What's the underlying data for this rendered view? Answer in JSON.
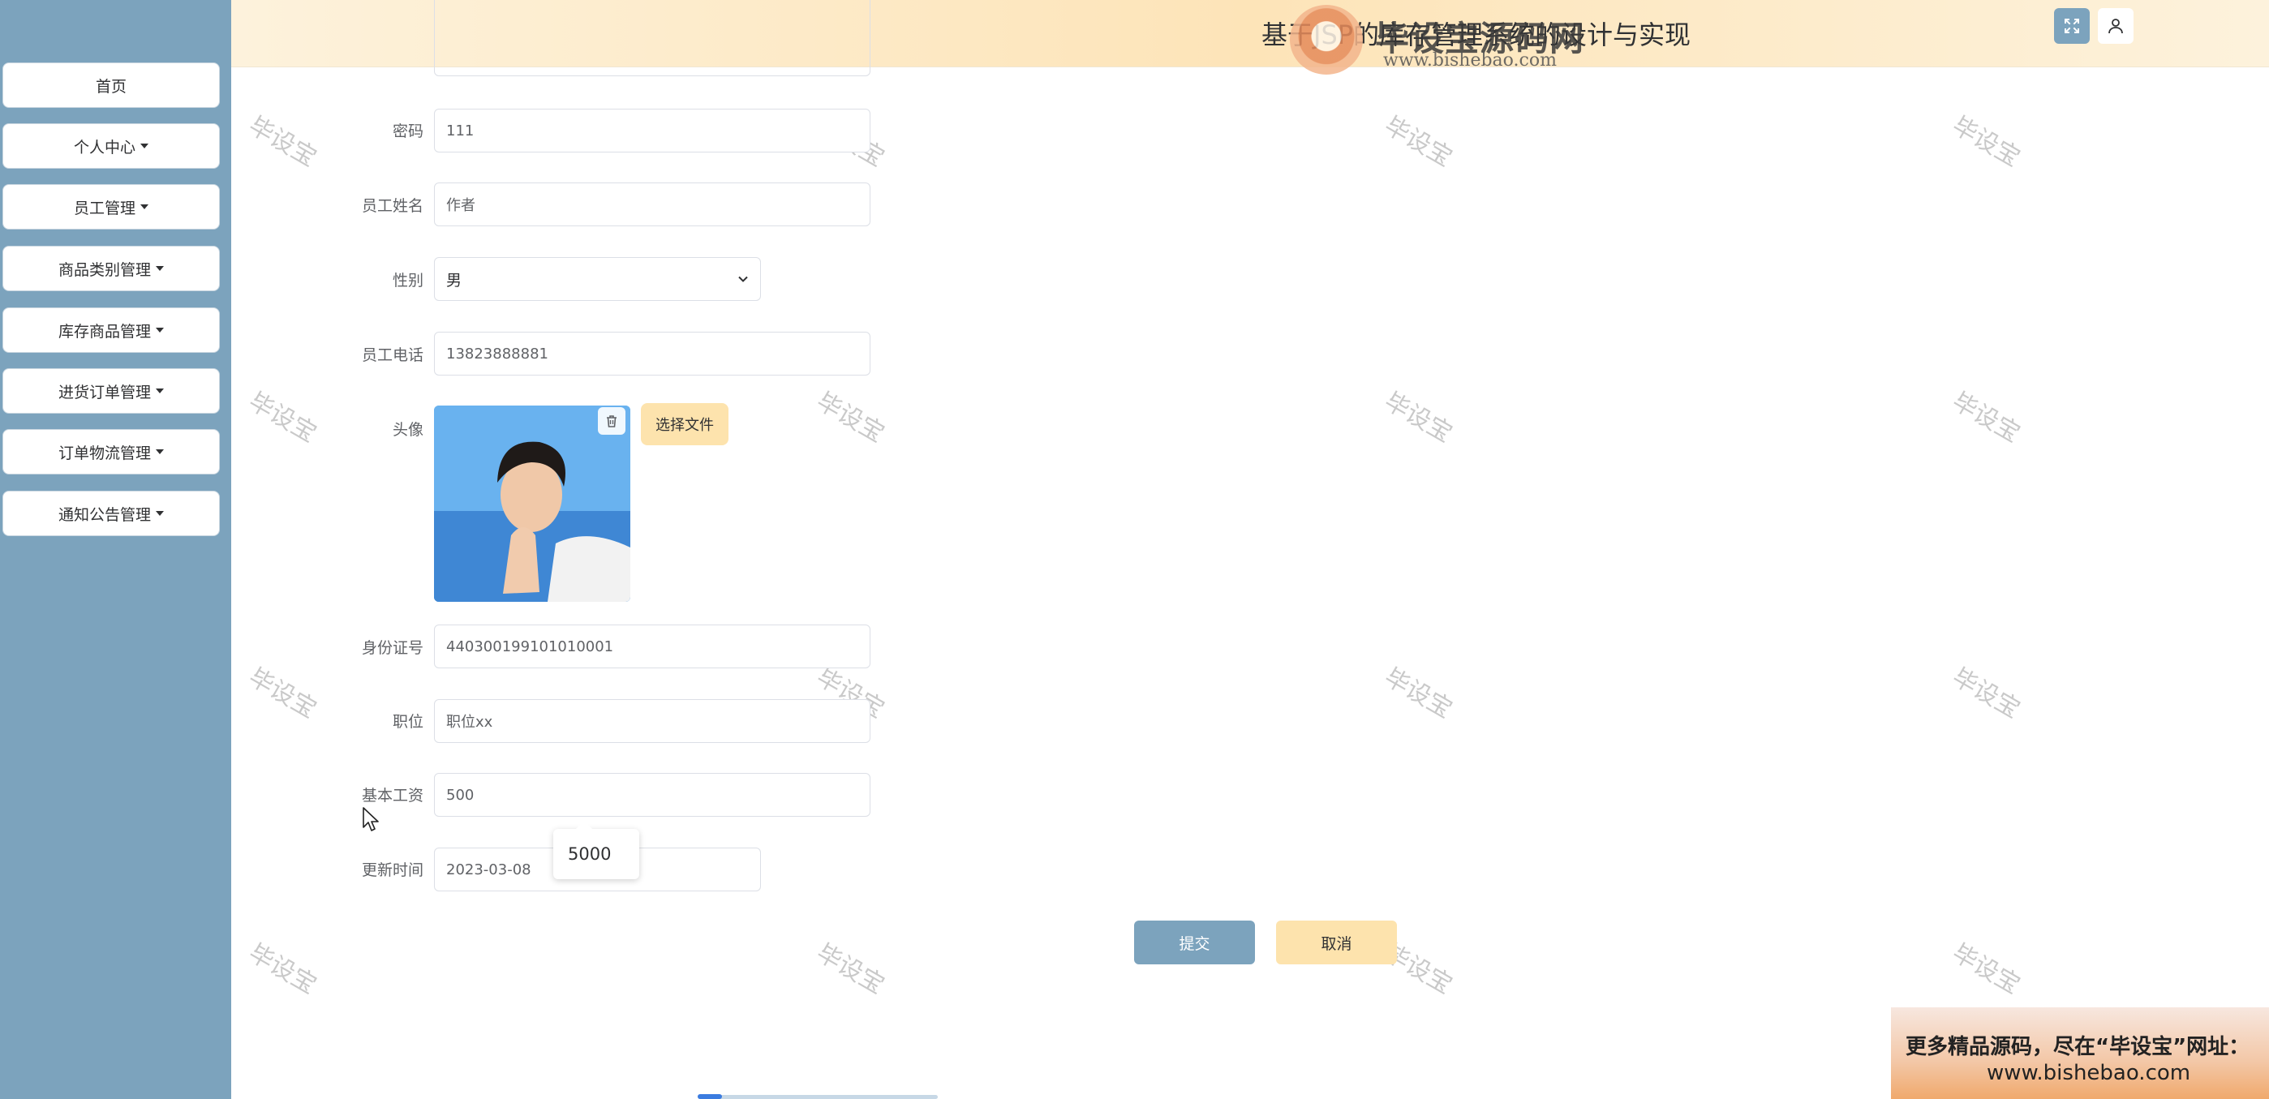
{
  "header": {
    "title": "基于JSP的库存管理系统的设计与实现",
    "watermark_brand": "毕设宝源码网",
    "watermark_url": "www.bishebao.com"
  },
  "sidebar": {
    "items": [
      {
        "label": "首页"
      },
      {
        "label": "个人中心"
      },
      {
        "label": "员工管理"
      },
      {
        "label": "商品类别管理"
      },
      {
        "label": "库存商品管理"
      },
      {
        "label": "进货订单管理"
      },
      {
        "label": "订单物流管理"
      },
      {
        "label": "通知公告管理"
      }
    ]
  },
  "form": {
    "password": {
      "label": "密码",
      "value": "111"
    },
    "name": {
      "label": "员工姓名",
      "value": "作者"
    },
    "gender": {
      "label": "性别",
      "value": "男"
    },
    "phone": {
      "label": "员工电话",
      "value": "13823888881"
    },
    "avatar": {
      "label": "头像",
      "file_button": "选择文件"
    },
    "id_card": {
      "label": "身份证号",
      "value": "440300199101010001"
    },
    "position": {
      "label": "职位",
      "value": "职位xx"
    },
    "salary": {
      "label": "基本工资",
      "value": "500",
      "suggestion": "5000"
    },
    "update_time": {
      "label": "更新时间",
      "value": "2023-03-08"
    },
    "submit_label": "提交",
    "cancel_label": "取消"
  },
  "watermark_text": "毕设宝",
  "ad": {
    "line1": "更多精品源码，尽在“毕设宝”网址：",
    "line2": "www.bishebao.com"
  },
  "colors": {
    "sidebar": "#7ca3bd",
    "header": "#fde4b8",
    "primary_button": "#7ca3bd",
    "secondary_button": "#fde3ad"
  },
  "icons": {
    "fullscreen": "expand-icon",
    "user": "user-icon",
    "delete": "trash-icon",
    "select": "chevron-down-icon"
  }
}
